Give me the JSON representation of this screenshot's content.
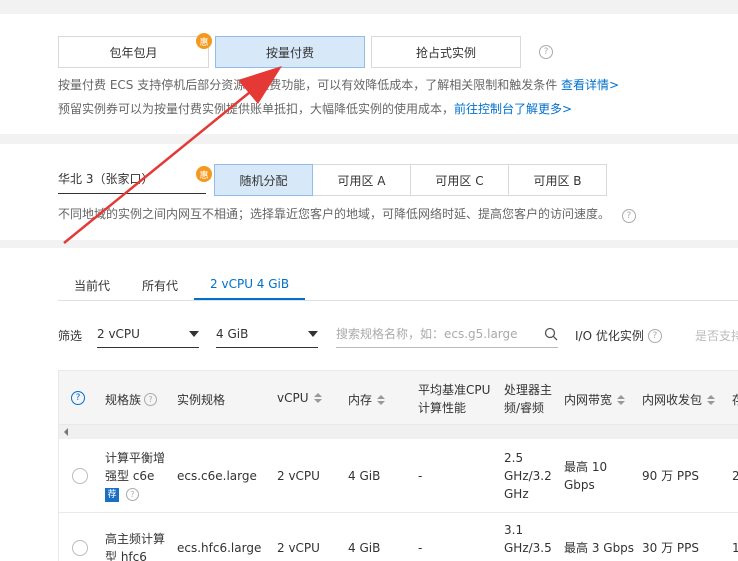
{
  "billing": {
    "options": [
      {
        "label": "包年包月",
        "badge": "惠"
      },
      {
        "label": "按量付费",
        "active": true
      },
      {
        "label": "抢占式实例"
      }
    ],
    "help": "?",
    "desc1_prefix": "按量付费 ECS 支持停机后部分资源不收费功能，可以有效降低成本，了解相关限制和触发条件 ",
    "desc1_link": "查看详情>",
    "desc2_prefix": "预留实例券可以为按量付费实例提供账单抵扣，大幅降低实例的使用成本，",
    "desc2_link": "前往控制台了解更多>"
  },
  "region": {
    "select_value": "华北 3（张家口）",
    "badge": "惠",
    "zones": [
      {
        "label": "随机分配",
        "active": true
      },
      {
        "label": "可用区 A"
      },
      {
        "label": "可用区 C"
      },
      {
        "label": "可用区 B"
      }
    ],
    "desc": "不同地域的实例之间内网互不相通；选择靠近您客户的地域，可降低网络时延、提高您客户的访问速度。",
    "help": "?"
  },
  "tabs": [
    "当前代",
    "所有代",
    "2 vCPU 4 GiB"
  ],
  "filter": {
    "label": "筛选",
    "cpu": "2 vCPU",
    "mem": "4 GiB",
    "search_placeholder": "搜索规格名称，如：ecs.g5.large",
    "io_label": "I/O 优化实例",
    "cut_text": "是否支持"
  },
  "table": {
    "headers": {
      "help": "?",
      "family": "规格族",
      "spec": "实例规格",
      "vcpu": "vCPU",
      "mem": "内存",
      "baseline_1": "平均基准CPU",
      "baseline_2": "计算性能",
      "proc_1": "处理器主",
      "proc_2": "频/睿频",
      "bw": "内网带宽",
      "pps": "内网收发包",
      "cut": "存"
    },
    "rows": [
      {
        "family_l1": "计算平衡增",
        "family_l2": "强型 c6e",
        "rec": "荐",
        "spec": "ecs.c6e.large",
        "vcpu": "2 vCPU",
        "mem": "4 GiB",
        "baseline": "-",
        "proc_l1": "2.5",
        "proc_l2": "GHz/3.2",
        "proc_l3": "GHz",
        "bw_l1": "最高 10",
        "bw_l2": "Gbps",
        "pps": "90 万 PPS",
        "cut": "2"
      },
      {
        "family_l1": "高主频计算",
        "family_l2": "型 hfc6",
        "spec": "ecs.hfc6.large",
        "vcpu": "2 vCPU",
        "mem": "4 GiB",
        "baseline": "-",
        "proc_l1": "3.1",
        "proc_l2": "GHz/3.5",
        "bw": "最高 3 Gbps",
        "pps": "30 万 PPS",
        "cut": "1"
      }
    ]
  },
  "colors": {
    "accent": "#0070cc",
    "active_bg": "#d7e8f9",
    "badge": "#f39a1e",
    "arrow": "#e53935"
  }
}
